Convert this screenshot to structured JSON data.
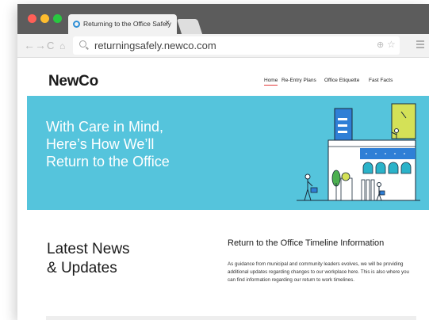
{
  "browser": {
    "tab_title": "Returning to the Office Safely",
    "tab_close": "×",
    "url": "returningsafely.newco.com",
    "icons": {
      "back": "back-arrow-icon",
      "forward": "forward-arrow-icon",
      "reload": "reload-icon",
      "home": "home-icon",
      "search": "search-icon",
      "zoom": "zoom-icon",
      "bookmark": "star-icon",
      "menu": "hamburger-menu-icon"
    },
    "traffic_lights": [
      "#ff5f57",
      "#ffbd2e",
      "#28c840"
    ]
  },
  "site": {
    "logo": "NewCo",
    "nav": [
      "Home",
      "Re-Entry Plans",
      "Office Etiquette",
      "Fast Facts"
    ],
    "active_nav": "Home",
    "accent_color": "#e33b3b"
  },
  "hero": {
    "headline_lines": [
      "With Care in Mind,",
      "Here’s How We’ll",
      "Return to the Office"
    ],
    "background_color": "#55c4dc"
  },
  "content": {
    "news_title_lines": [
      "Latest News",
      "& Updates"
    ],
    "timeline_title": "Return to the Office Timeline Information",
    "timeline_text": "As guidance from municipal and community leaders evolves, we will be providing additional updates regarding changes to our workplace here. This is also where you can find information regarding our return to work timelines."
  }
}
